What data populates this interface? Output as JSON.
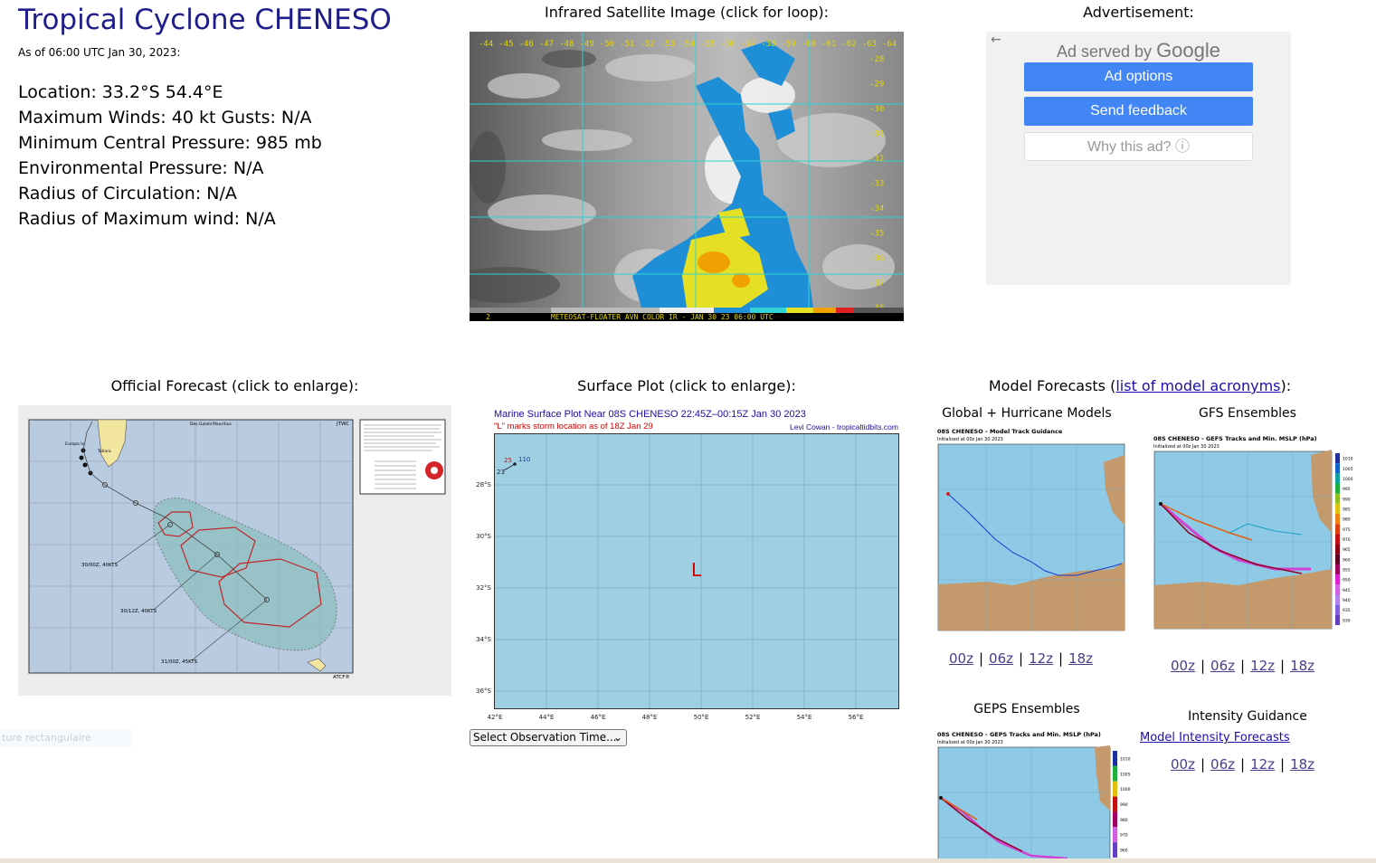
{
  "storm": {
    "title": "Tropical Cyclone CHENESO",
    "as_of": "As of 06:00 UTC Jan 30, 2023:",
    "stats": [
      "Location: 33.2°S 54.4°E",
      "Maximum Winds: 40 kt  Gusts: N/A",
      "Minimum Central Pressure: 985 mb",
      "Environmental Pressure: N/A",
      "Radius of Circulation: N/A",
      "Radius of Maximum wind: N/A"
    ]
  },
  "satellite": {
    "title": "Infrared Satellite Image (click for loop):",
    "lon_labels": [
      "-44",
      "-45",
      "-46",
      "-47",
      "-48",
      "-49",
      "-50",
      "-51",
      "-52",
      "-53",
      "-54",
      "-55",
      "-56",
      "-57",
      "-58",
      "-59",
      "-60",
      "-61",
      "-62",
      "-63",
      "-64"
    ],
    "lat_labels": [
      "-28",
      "-29",
      "-30",
      "-31",
      "-32",
      "-33",
      "-34",
      "-35",
      "-36",
      "-37",
      "-38"
    ],
    "caption": "METEOSAT-FLOATER AVN COLOR IR - JAN 30 23 06:00 UTC",
    "corner": "2"
  },
  "ad": {
    "heading": "Advertisement:",
    "served_by": "Ad served by",
    "google": "Google",
    "back_icon": "←",
    "options": "Ad options",
    "feedback": "Send feedback",
    "why": "Why this ad? ⓘ"
  },
  "official": {
    "title": "Official Forecast (click to enlarge):",
    "labels": [
      "30/00Z, 40KTS",
      "30/12Z, 40KTS",
      "31/00Z, 45KTS"
    ],
    "agency": "JTWC",
    "region": "ATCF®",
    "place_labels": [
      "Mauritius",
      "Europa Is",
      "Toliara",
      "Des Galets"
    ]
  },
  "surface": {
    "title": "Surface Plot (click to enlarge):",
    "plot_title": "Marine Surface Plot Near 08S CHENESO 22:45Z–00:15Z Jan 30 2023",
    "plot_sub": "\"L\" marks storm location as of 18Z Jan 29",
    "credit": "Levi Cowan - tropicaltidbits.com",
    "marker": "L",
    "lon_labels": [
      "42°E",
      "44°E",
      "46°E",
      "48°E",
      "50°E",
      "52°E",
      "54°E",
      "56°E"
    ],
    "lat_labels": [
      "28°S",
      "30°S",
      "32°S",
      "34°S",
      "36°S"
    ],
    "station": {
      "temp": "25",
      "pressure": "110",
      "dew": "23"
    },
    "select_label": "Select Observation Time..."
  },
  "ghost_text": "ture rectangulaire",
  "models": {
    "title_prefix": "Model Forecasts (",
    "title_link": "list of model acronyms",
    "title_suffix": "):",
    "global": {
      "title": "Global + Hurricane Models",
      "plot_title": "08S CHENESO - Model Track Guidance",
      "plot_sub": "Initialized at 00z Jan 30 2023",
      "links": [
        "00z",
        "06z",
        "12z",
        "18z"
      ]
    },
    "gfs": {
      "title": "GFS Ensembles",
      "plot_title": "08S CHENESO - GEFS Tracks and Min. MSLP (hPa)",
      "plot_sub": "Initialized at 00z Jan 30 2023",
      "scale": [
        "1010",
        "1005",
        "1000",
        "995",
        "990",
        "985",
        "980",
        "975",
        "970",
        "965",
        "960",
        "955",
        "950",
        "945",
        "940",
        "935",
        "930"
      ],
      "links": [
        "00z",
        "06z",
        "12z",
        "18z"
      ]
    },
    "geps": {
      "title": "GEPS Ensembles",
      "plot_title": "08S CHENESO - GEPS Tracks and Min. MSLP (hPa)",
      "plot_sub": "Initialized at 00z Jan 30 2023",
      "scale": [
        "1010",
        "1005",
        "1000",
        "990",
        "980",
        "970",
        "960"
      ]
    },
    "intensity": {
      "title": "Intensity Guidance",
      "link": "Model Intensity Forecasts",
      "links": [
        "00z",
        "06z",
        "12z",
        "18z"
      ]
    },
    "colors": {
      "land": "#c49a6c",
      "ocean": "#8ec9e6",
      "sep": "|"
    }
  }
}
